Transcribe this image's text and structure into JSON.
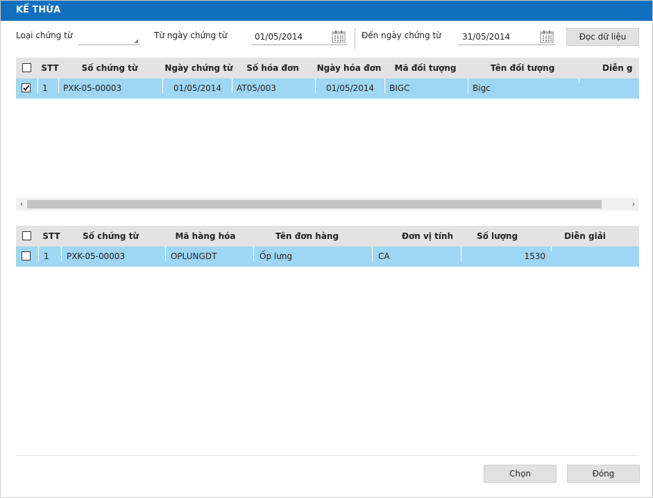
{
  "window": {
    "title": "KẾ THỪA"
  },
  "filters": {
    "voucher_type_label": "Loại chứng từ",
    "voucher_type_value": "",
    "from_date_label": "Từ ngày chứng từ",
    "from_date_value": "01/05/2014",
    "to_date_label": "Đến ngày chứng từ",
    "to_date_value": "31/05/2014",
    "read_button": "Đọc dữ liệu"
  },
  "top_grid": {
    "columns": [
      "STT",
      "Số chứng từ",
      "Ngày chứng từ",
      "Số hóa đơn",
      "Ngày hóa đơn",
      "Mã đối tượng",
      "Tên đối tượng",
      "Diễn g"
    ],
    "rows": [
      {
        "checked": true,
        "stt": "1",
        "so_chung_tu": "PXK-05-00003",
        "ngay_chung_tu": "01/05/2014",
        "so_hoa_don": "AT05/003",
        "ngay_hoa_don": "01/05/2014",
        "ma_doi_tuong": "BIGC",
        "ten_doi_tuong": "Bigc",
        "dien_giai": ""
      }
    ]
  },
  "bottom_grid": {
    "columns": [
      "STT",
      "Số chứng từ",
      "Mã hàng hóa",
      "Tên đơn hàng",
      "Đơn vị tính",
      "Số lượng",
      "Diễn giải"
    ],
    "rows": [
      {
        "checked": false,
        "stt": "1",
        "so_chung_tu": "PXK-05-00003",
        "ma_hang_hoa": "OPLUNGDT",
        "ten_don_hang": "Ốp lưng",
        "don_vi_tinh": "CA",
        "so_luong": "1530",
        "dien_giai": ""
      }
    ]
  },
  "footer": {
    "select_button": "Chọn",
    "close_button": "Đóng"
  },
  "colors": {
    "titlebar": "#1170bd",
    "selected_row": "#9fd6f1",
    "header_bg": "#e3e3e3"
  }
}
